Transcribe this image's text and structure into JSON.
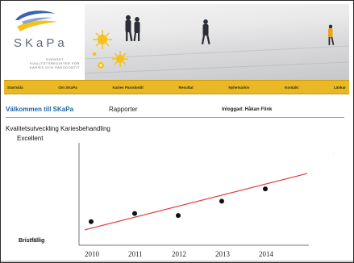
{
  "app": {
    "brand": "SKaPa",
    "tagline": "SVENSKT KVALITETSREGISTER FÖR KARIES OCH PARODONTIT",
    "colors": {
      "nav": "#e8b825",
      "welcome": "#1e66a8",
      "trend": "#e23c3c"
    }
  },
  "nav": {
    "items": [
      "Startsida",
      "Om SKaPa",
      "Karies Parodontit",
      "Resultat",
      "Nyhetsarkiv",
      "Kontakt",
      "Länkar"
    ]
  },
  "page": {
    "welcome": "Välkommen till SKaPa",
    "reports": "Rapporter",
    "logged_in": "Inloggad: Håkan Flink"
  },
  "chart_data": {
    "type": "scatter",
    "title": "Kvalitetsutveckling Kariesbehandling",
    "xlabel": "",
    "ylabel": "",
    "y_top_label": "Excellent",
    "y_bottom_label": "Bristfällig",
    "categories": [
      "2010",
      "2011",
      "2012",
      "2013",
      "2014"
    ],
    "x": [
      2010,
      2011,
      2012,
      2013,
      2014
    ],
    "values": [
      2.3,
      3.1,
      2.9,
      4.3,
      5.5
    ],
    "ylim": [
      0,
      10
    ],
    "trendline": {
      "start": 1.5,
      "end": 7.0
    },
    "grid": false,
    "legend": "none"
  }
}
